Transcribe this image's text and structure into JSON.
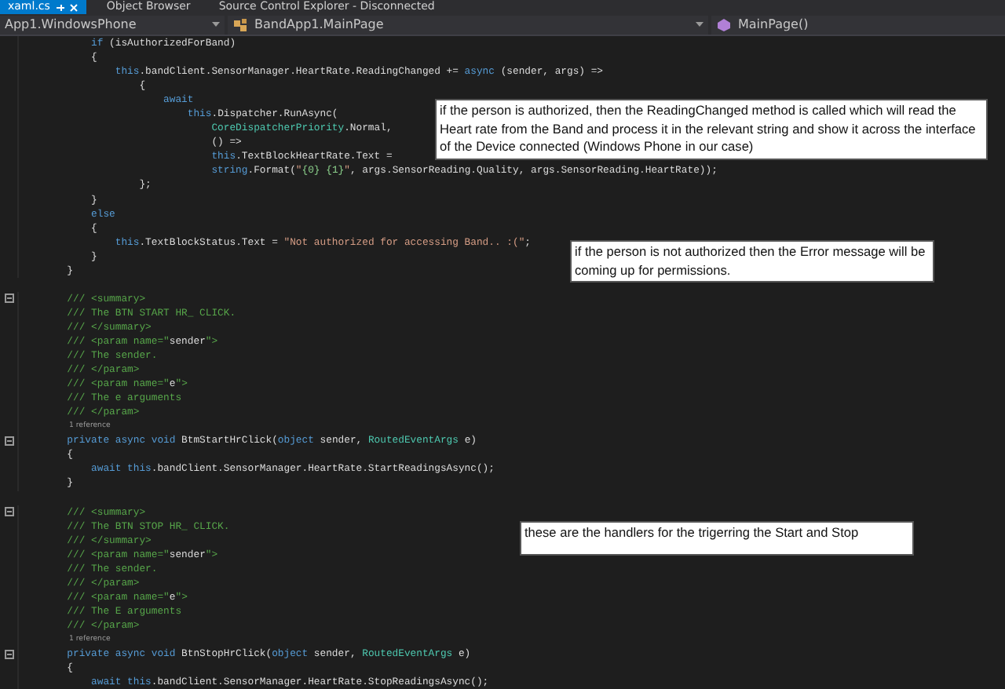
{
  "tabs": [
    {
      "label": "xaml.cs",
      "selected": true,
      "pinned": true,
      "closable": true
    },
    {
      "label": "Object Browser",
      "selected": false,
      "pinned": false,
      "closable": false
    },
    {
      "label": "Source Control Explorer - Disconnected",
      "selected": false,
      "pinned": false,
      "closable": false
    }
  ],
  "navigation_bar": [
    {
      "label": "App1.WindowsPhone",
      "kind": "project"
    },
    {
      "label": "BandApp1.MainPage",
      "kind": "class"
    },
    {
      "label": "MainPage()",
      "kind": "method"
    }
  ],
  "code_lines": [
    {
      "kind": "code",
      "fold": false,
      "segments": [
        {
          "text": "            if ",
          "kind": "keyword"
        },
        {
          "text": "(isAuthorizedForBand)",
          "kind": "plain"
        }
      ]
    },
    {
      "kind": "code",
      "fold": false,
      "segments": [
        {
          "text": "            {",
          "kind": "plain"
        }
      ]
    },
    {
      "kind": "code",
      "fold": false,
      "segments": [
        {
          "text": "                this",
          "kind": "keyword"
        },
        {
          "text": ".bandClient.SensorManager.HeartRate.ReadingChanged += ",
          "kind": "plain"
        },
        {
          "text": "async",
          "kind": "keyword"
        },
        {
          "text": " (sender, args) =>",
          "kind": "plain"
        }
      ]
    },
    {
      "kind": "code",
      "fold": false,
      "segments": [
        {
          "text": "                    {",
          "kind": "plain"
        }
      ]
    },
    {
      "kind": "code",
      "fold": false,
      "segments": [
        {
          "text": "                        await",
          "kind": "keyword"
        }
      ]
    },
    {
      "kind": "code",
      "fold": false,
      "segments": [
        {
          "text": "                            this",
          "kind": "keyword"
        },
        {
          "text": ".Dispatcher.RunAsync(",
          "kind": "plain"
        }
      ]
    },
    {
      "kind": "code",
      "fold": false,
      "segments": [
        {
          "text": "                                CoreDispatcherPriority",
          "kind": "type"
        },
        {
          "text": ".Normal,",
          "kind": "plain"
        }
      ]
    },
    {
      "kind": "code",
      "fold": false,
      "segments": [
        {
          "text": "                                () =>",
          "kind": "plain"
        }
      ]
    },
    {
      "kind": "code",
      "fold": false,
      "segments": [
        {
          "text": "                                this",
          "kind": "keyword"
        },
        {
          "text": ".TextBlockHeartRate.Text =",
          "kind": "plain"
        }
      ]
    },
    {
      "kind": "code",
      "fold": false,
      "segments": [
        {
          "text": "                                string",
          "kind": "keyword"
        },
        {
          "text": ".Format(",
          "kind": "plain"
        },
        {
          "text": "\"",
          "kind": "string"
        },
        {
          "text": "{0} {1}",
          "kind": "format"
        },
        {
          "text": "\"",
          "kind": "string"
        },
        {
          "text": ", args.SensorReading.Quality, args.SensorReading.HeartRate));",
          "kind": "plain"
        }
      ]
    },
    {
      "kind": "code",
      "fold": false,
      "segments": [
        {
          "text": "                    };",
          "kind": "plain"
        }
      ]
    },
    {
      "kind": "code",
      "fold": false,
      "segments": [
        {
          "text": "            }",
          "kind": "plain"
        }
      ]
    },
    {
      "kind": "code",
      "fold": false,
      "segments": [
        {
          "text": "            else",
          "kind": "keyword"
        }
      ]
    },
    {
      "kind": "code",
      "fold": false,
      "segments": [
        {
          "text": "            {",
          "kind": "plain"
        }
      ]
    },
    {
      "kind": "code",
      "fold": false,
      "segments": [
        {
          "text": "                this",
          "kind": "keyword"
        },
        {
          "text": ".TextBlockStatus.Text = ",
          "kind": "plain"
        },
        {
          "text": "\"Not authorized for accessing Band.. :(\"",
          "kind": "string"
        },
        {
          "text": ";",
          "kind": "plain"
        }
      ]
    },
    {
      "kind": "code",
      "fold": false,
      "segments": [
        {
          "text": "            }",
          "kind": "plain"
        }
      ]
    },
    {
      "kind": "code",
      "fold": false,
      "segments": [
        {
          "text": "        }",
          "kind": "plain"
        }
      ]
    },
    {
      "kind": "blank"
    },
    {
      "kind": "code",
      "fold": true,
      "segments": [
        {
          "text": "        /// <summary>",
          "kind": "comment"
        }
      ]
    },
    {
      "kind": "code",
      "fold": false,
      "segments": [
        {
          "text": "        /// The BTN START HR_ CLICK.",
          "kind": "comment"
        }
      ]
    },
    {
      "kind": "code",
      "fold": false,
      "segments": [
        {
          "text": "        /// </summary>",
          "kind": "comment"
        }
      ]
    },
    {
      "kind": "code",
      "fold": false,
      "segments": [
        {
          "text": "        /// <param name=\"",
          "kind": "comment"
        },
        {
          "text": "sender",
          "kind": "plain"
        },
        {
          "text": "\">",
          "kind": "comment"
        }
      ]
    },
    {
      "kind": "code",
      "fold": false,
      "segments": [
        {
          "text": "        /// The sender.",
          "kind": "comment"
        }
      ]
    },
    {
      "kind": "code",
      "fold": false,
      "segments": [
        {
          "text": "        /// </param>",
          "kind": "comment"
        }
      ]
    },
    {
      "kind": "code",
      "fold": false,
      "segments": [
        {
          "text": "        /// <param name=\"",
          "kind": "comment"
        },
        {
          "text": "e",
          "kind": "plain"
        },
        {
          "text": "\">",
          "kind": "comment"
        }
      ]
    },
    {
      "kind": "code",
      "fold": false,
      "segments": [
        {
          "text": "        /// The e arguments",
          "kind": "comment"
        }
      ]
    },
    {
      "kind": "code",
      "fold": false,
      "segments": [
        {
          "text": "        /// </param>",
          "kind": "comment"
        }
      ]
    },
    {
      "kind": "codelens",
      "text": "1 reference"
    },
    {
      "kind": "code",
      "fold": true,
      "segments": [
        {
          "text": "        private async void ",
          "kind": "keyword"
        },
        {
          "text": "BtmStartHrClick(",
          "kind": "plain"
        },
        {
          "text": "object",
          "kind": "keyword"
        },
        {
          "text": " sender, ",
          "kind": "plain"
        },
        {
          "text": "RoutedEventArgs",
          "kind": "type"
        },
        {
          "text": " e)",
          "kind": "plain"
        }
      ]
    },
    {
      "kind": "code",
      "fold": false,
      "segments": [
        {
          "text": "        {",
          "kind": "plain"
        }
      ]
    },
    {
      "kind": "code",
      "fold": false,
      "segments": [
        {
          "text": "            await this",
          "kind": "keyword"
        },
        {
          "text": ".bandClient.SensorManager.HeartRate.StartReadingsAsync();",
          "kind": "plain"
        }
      ]
    },
    {
      "kind": "code",
      "fold": false,
      "segments": [
        {
          "text": "        }",
          "kind": "plain"
        }
      ]
    },
    {
      "kind": "blank"
    },
    {
      "kind": "code",
      "fold": true,
      "segments": [
        {
          "text": "        /// <summary>",
          "kind": "comment"
        }
      ]
    },
    {
      "kind": "code",
      "fold": false,
      "segments": [
        {
          "text": "        /// The BTN STOP HR_ CLICK.",
          "kind": "comment"
        }
      ]
    },
    {
      "kind": "code",
      "fold": false,
      "segments": [
        {
          "text": "        /// </summary>",
          "kind": "comment"
        }
      ]
    },
    {
      "kind": "code",
      "fold": false,
      "segments": [
        {
          "text": "        /// <param name=\"",
          "kind": "comment"
        },
        {
          "text": "sender",
          "kind": "plain"
        },
        {
          "text": "\">",
          "kind": "comment"
        }
      ]
    },
    {
      "kind": "code",
      "fold": false,
      "segments": [
        {
          "text": "        /// The sender.",
          "kind": "comment"
        }
      ]
    },
    {
      "kind": "code",
      "fold": false,
      "segments": [
        {
          "text": "        /// </param>",
          "kind": "comment"
        }
      ]
    },
    {
      "kind": "code",
      "fold": false,
      "segments": [
        {
          "text": "        /// <param name=\"",
          "kind": "comment"
        },
        {
          "text": "e",
          "kind": "plain"
        },
        {
          "text": "\">",
          "kind": "comment"
        }
      ]
    },
    {
      "kind": "code",
      "fold": false,
      "segments": [
        {
          "text": "        /// The E arguments",
          "kind": "comment"
        }
      ]
    },
    {
      "kind": "code",
      "fold": false,
      "segments": [
        {
          "text": "        /// </param>",
          "kind": "comment"
        }
      ]
    },
    {
      "kind": "codelens",
      "text": "1 reference"
    },
    {
      "kind": "code",
      "fold": true,
      "segments": [
        {
          "text": "        private async void ",
          "kind": "keyword"
        },
        {
          "text": "BtnStopHrClick(",
          "kind": "plain"
        },
        {
          "text": "object",
          "kind": "keyword"
        },
        {
          "text": " sender, ",
          "kind": "plain"
        },
        {
          "text": "RoutedEventArgs",
          "kind": "type"
        },
        {
          "text": " e)",
          "kind": "plain"
        }
      ]
    },
    {
      "kind": "code",
      "fold": false,
      "segments": [
        {
          "text": "        {",
          "kind": "plain"
        }
      ]
    },
    {
      "kind": "code",
      "fold": false,
      "segments": [
        {
          "text": "            await this",
          "kind": "keyword"
        },
        {
          "text": ".bandClient.SensorManager.HeartRate.StopReadingsAsync();",
          "kind": "plain"
        }
      ]
    }
  ],
  "annotations": [
    {
      "text": "if the person is authorized, then the ReadingChanged method is called which will read the Heart rate from the Band and process it in the relevant string and show it across the interface of the Device connected (Windows Phone in our case)"
    },
    {
      "text": "if the person is not authorized then the Error message will be coming up for permissions."
    },
    {
      "text": "these are the handlers for the trigerring the Start and Stop"
    }
  ]
}
